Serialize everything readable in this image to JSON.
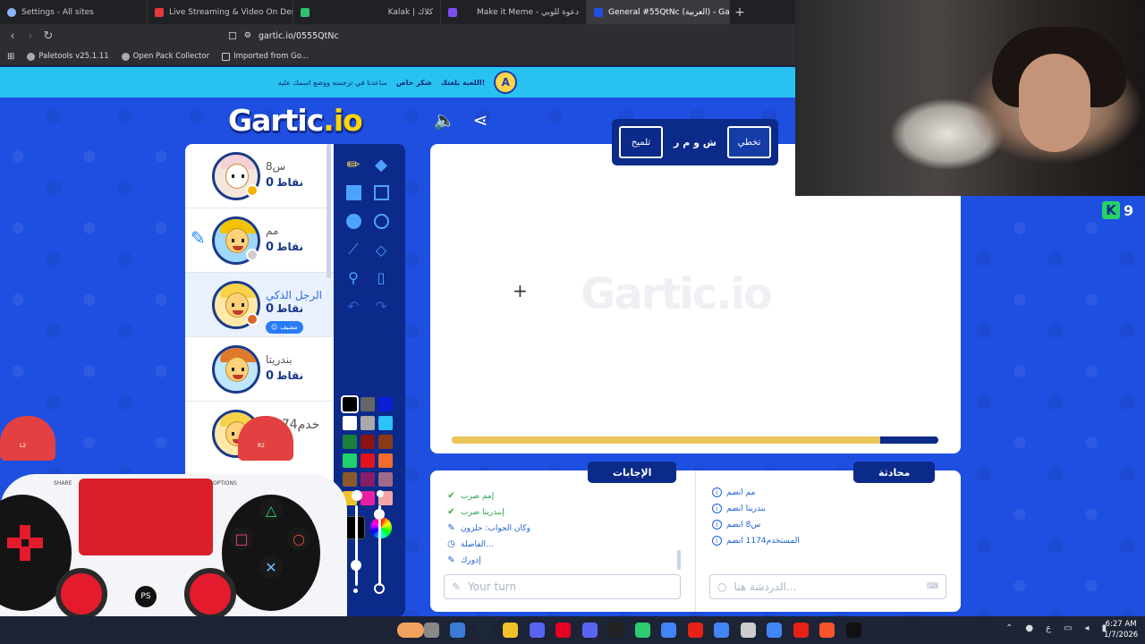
{
  "browser": {
    "tabs": [
      {
        "label": "Settings - All sites",
        "color": "#8ab4f8"
      },
      {
        "label": "Live Streaming & Video On Demand",
        "color": "#e23b3b"
      },
      {
        "label": "",
        "color": "#2fbf71"
      },
      {
        "label": "Kalak | كلاك",
        "color": "#ffffff"
      },
      {
        "label": "Make it Meme - دعوة للوبي",
        "color": "#7a4df0"
      },
      {
        "label": "General #55QtNc (العربية) - Gartic",
        "color": "#1f4fe0",
        "active": true
      }
    ],
    "url": "gartic.io/0555QtNc",
    "bookmarks": [
      "Paletools v25.1.11",
      "Open Pack Collector",
      "Imported from Go..."
    ]
  },
  "banner": {
    "text": "ساعدنا في ترجمته ووضع اسمك عليه",
    "highlight": "شكر خاص",
    "suffix": "بلعبة",
    "cta": "اللعبة بلغتك!",
    "icon_letter": "A"
  },
  "logo": {
    "main": "Gartic",
    "suffix": ".io"
  },
  "players": [
    {
      "name": "س8",
      "score": "0",
      "points_label": "نقاط",
      "status": "#f5b400",
      "hair": "#f3d1d6",
      "badge": ""
    },
    {
      "name": "مم",
      "score": "0",
      "points_label": "نقاط",
      "status": "#cfcfcf",
      "hair": "#f2c400",
      "badge": ""
    },
    {
      "name": "الرجل الذكي",
      "score": "0",
      "points_label": "نقاط",
      "status": "#e0652b",
      "hair": "#f7d34a",
      "badge": "مضيف",
      "active": true
    },
    {
      "name": "بندريتا",
      "score": "0",
      "points_label": "نقاط",
      "status": "",
      "hair": "#e07a2b",
      "badge": ""
    },
    {
      "name": "1174خدم",
      "score": "",
      "points_label": "",
      "status": "",
      "hair": "#f7d34a",
      "badge": ""
    }
  ],
  "tools": {
    "palette": [
      "#000000",
      "#666666",
      "#0a1fd6",
      "#ffffff",
      "#aaaaaa",
      "#29c5f6",
      "#1a7f3a",
      "#8a1313",
      "#8a3a14",
      "#23d16a",
      "#e0121c",
      "#f26b2c",
      "#8a5a2a",
      "#8a1b6b",
      "#a06a8a",
      "#f2c12a",
      "#e81fa0",
      "#f4a6a6"
    ],
    "selected_color": "#000000"
  },
  "canvas": {
    "watermark": "Gartic.io",
    "timer_fraction": 0.88,
    "word_hint": "ش و م ر",
    "skip_label": "تخطي",
    "hint_label": "تلميح"
  },
  "answers": {
    "title": "الإجابات",
    "messages": [
      {
        "type": "ok",
        "text": "إمم ضرب"
      },
      {
        "type": "ok",
        "text": "إبندريتا ضرب"
      },
      {
        "type": "draw",
        "text": "وكان الجواب: حلزون"
      },
      {
        "type": "timer",
        "text": "الفاصلة..."
      },
      {
        "type": "draw",
        "text": "إدورك"
      }
    ],
    "input_placeholder": "Your turn"
  },
  "chat": {
    "title": "محادثة",
    "messages": [
      {
        "text": "مم انضم"
      },
      {
        "text": "بندريتا انضم"
      },
      {
        "text": "س8 انضم"
      },
      {
        "text": "المستخدم1174 انضم"
      }
    ],
    "input_placeholder": "الدردشة هنا..."
  },
  "corner_score": {
    "letter": "K",
    "value": "9"
  },
  "controller": {
    "share": "SHARE",
    "options": "OPTIONS",
    "ps": "PS",
    "l2": "L2",
    "r2": "R2"
  },
  "taskbar": {
    "time": "6:27 AM",
    "date": "1/7/2026",
    "lang": "ع"
  }
}
